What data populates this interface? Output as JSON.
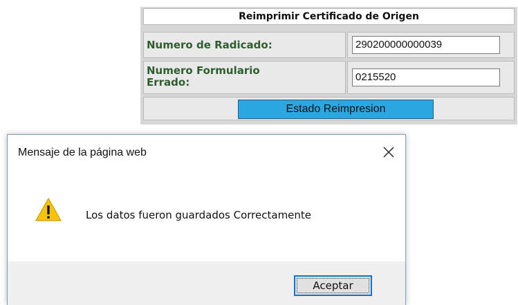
{
  "form": {
    "title": "Reimprimir Certificado de Origen",
    "radicado_label": "Numero de Radicado:",
    "radicado_value": "290200000000039",
    "formulario_label_line1": "Numero Formulario",
    "formulario_label_line2": "Errado:",
    "formulario_value": "0215520",
    "estado_button_label": "Estado Reimpresion"
  },
  "dialog": {
    "title": "Mensaje de la página web",
    "message": "Los datos fueron guardados Correctamente",
    "ok_label": "Aceptar",
    "icon": "warning-icon",
    "close_icon": "close-icon"
  },
  "colors": {
    "label_green": "#2e5d2e",
    "button_blue": "#2aa6e0",
    "warning_yellow": "#f6c400",
    "focus_blue": "#0078d7"
  }
}
